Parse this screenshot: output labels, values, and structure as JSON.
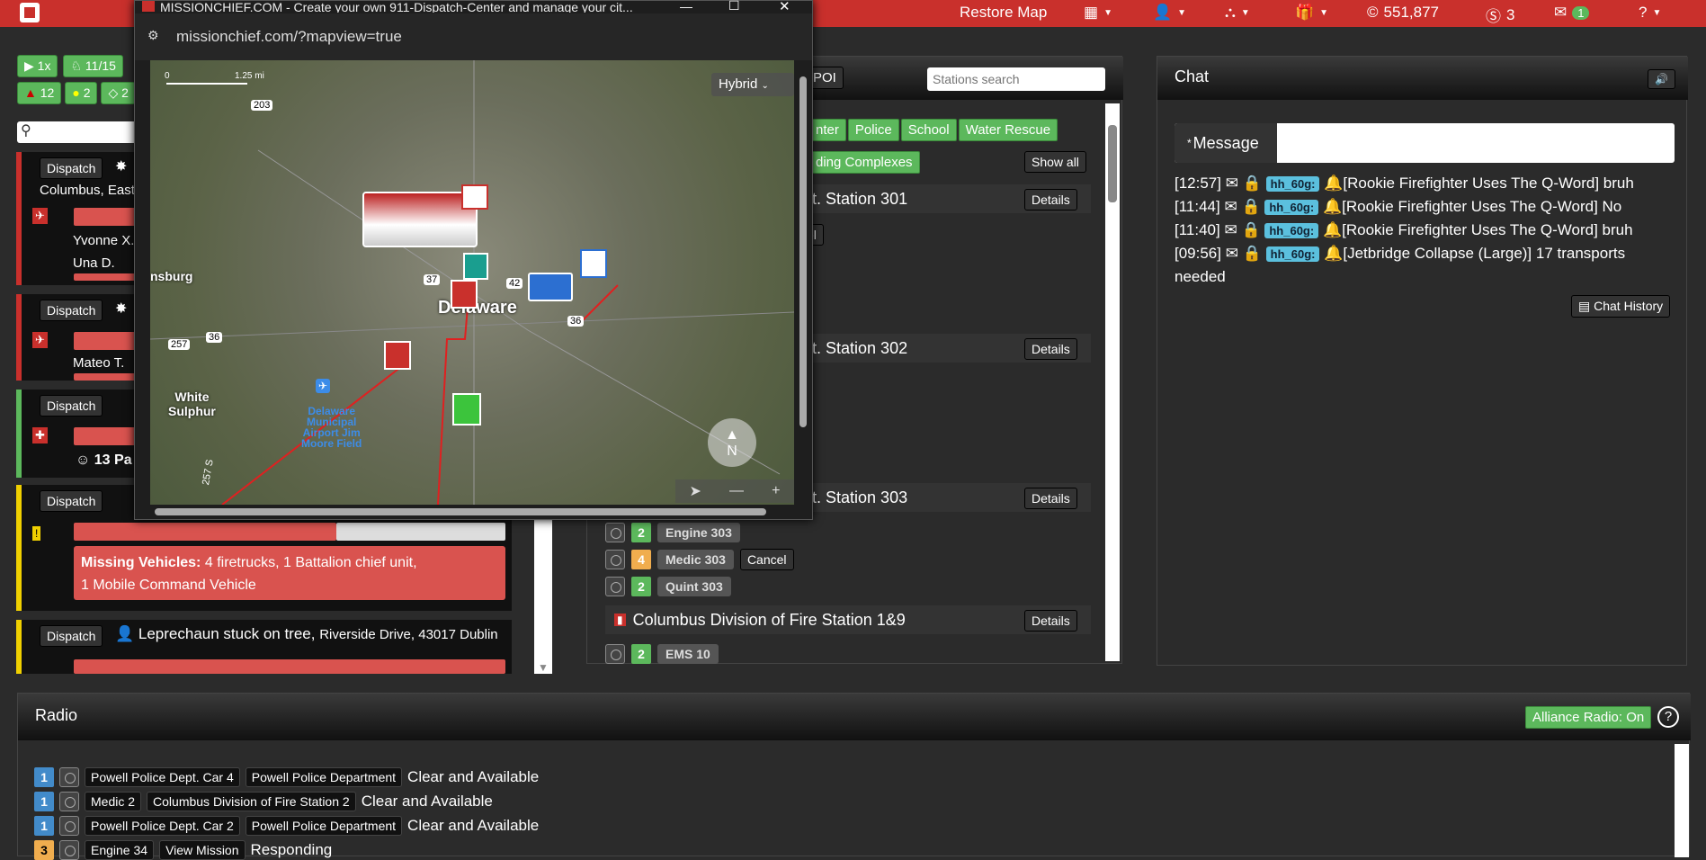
{
  "topbar": {
    "restore_map": "Restore Map",
    "credits": "551,877",
    "coins": "3",
    "messages_count": "1"
  },
  "left": {
    "speed": "1x",
    "alerts": "11/15",
    "red_count": "12",
    "yellow_count": "2",
    "green_count": "2",
    "missions": [
      {
        "dispatch": "Dispatch",
        "sub": "Columbus, East",
        "people": [
          "Yvonne X.",
          "Una D."
        ]
      },
      {
        "dispatch": "Dispatch",
        "people": [
          "Mateo T."
        ]
      },
      {
        "dispatch": "Dispatch",
        "patients": "13 Pa"
      },
      {
        "dispatch": "Dispatch",
        "missing_label": "Missing Vehicles:",
        "missing_text": "4 firetrucks, 1 Battalion chief unit,",
        "missing_text2": "1 Mobile Command Vehicle"
      },
      {
        "dispatch": "Dispatch",
        "title": "Leprechaun stuck on tree,",
        "address": "Riverside Drive, 43017 Dublin"
      }
    ]
  },
  "popup": {
    "title": "MISSIONCHIEF.COM - Create your own 911-Dispatch-Center and manage your cit...",
    "url": "missionchief.com/?mapview=true",
    "map_type": "Hybrid",
    "scale_0": "0",
    "scale_val": "1.25 mi",
    "compass": "N",
    "labels": {
      "delaware": "Delaware",
      "white_sulphur": "White\nSulphur",
      "nsburg": "nsburg",
      "airport": "Delaware\nMunicipal\nAirport Jim\nMoore Field",
      "r203": "203",
      "r257": "257",
      "r36": "36",
      "r42": "42",
      "r37": "37",
      "r36b": "36",
      "r257s": "257 S"
    }
  },
  "stations": {
    "poi": "w POI",
    "search_placeholder": "Stations search",
    "filters": [
      "nter",
      "Police",
      "School",
      "Water Rescue"
    ],
    "filter2": "ding Complexes",
    "show_all": "Show all",
    "details": "Details",
    "cancel": "Cancel",
    "cancel_partial": "el",
    "station_301": "pt. Station 301",
    "station_302": "pt. Station 302",
    "station_303": "pt. Station 303",
    "station_col": "Columbus Division of Fire Station 1&9",
    "vehicles_303": [
      {
        "status": "2",
        "name": "Engine 303"
      },
      {
        "status": "4",
        "name": "Medic 303"
      },
      {
        "status": "2",
        "name": "Quint 303"
      }
    ],
    "vehicles_col": [
      {
        "status": "2",
        "name": "EMS 10"
      }
    ]
  },
  "chat": {
    "title": "Chat",
    "message_label": "Message",
    "star": "*",
    "history": "Chat History",
    "lines": [
      {
        "time": "[12:57]",
        "user": "hh_60g:",
        "text": "[Rookie Firefighter Uses The Q-Word] bruh"
      },
      {
        "time": "[11:44]",
        "user": "hh_60g:",
        "text": "[Rookie Firefighter Uses The Q-Word] No"
      },
      {
        "time": "[11:40]",
        "user": "hh_60g:",
        "text": "[Rookie Firefighter Uses The Q-Word] bruh"
      },
      {
        "time": "[09:56]",
        "user": "hh_60g:",
        "text": "[Jetbridge Collapse (Large)] 17 transports"
      }
    ],
    "wrap": "needed"
  },
  "radio": {
    "title": "Radio",
    "alliance": "Alliance Radio: On",
    "help": "?",
    "rows": [
      {
        "status": "1",
        "vehicle": "Powell Police Dept. Car 4",
        "station": "Powell Police Department",
        "text": "Clear and Available"
      },
      {
        "status": "1",
        "vehicle": "Medic 2",
        "station": "Columbus Division of Fire Station 2",
        "text": "Clear and Available"
      },
      {
        "status": "1",
        "vehicle": "Powell Police Dept. Car 2",
        "station": "Powell Police Department",
        "text": "Clear and Available"
      },
      {
        "status": "3",
        "vehicle": "Engine 34",
        "station": "View Mission",
        "text": "Responding"
      }
    ]
  },
  "colors": {
    "red": "#c9302c",
    "green": "#5cb85c",
    "status_blue": "#428bca",
    "status_yellow": "#f0ad4e"
  }
}
